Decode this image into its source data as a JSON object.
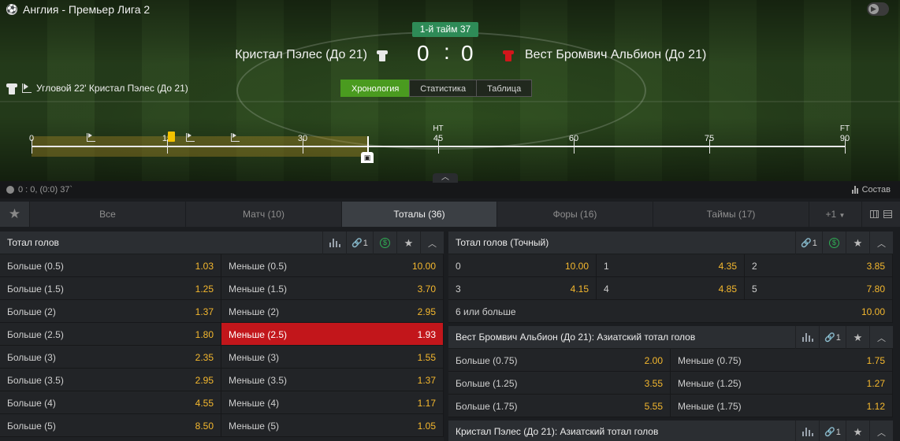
{
  "header": {
    "league": "Англия - Премьер Лига 2",
    "period": "1-й тайм 37",
    "home_team": "Кристал Пэлес (До 21)",
    "away_team": "Вест Бромвич Альбион (До 21)",
    "home_score": "0",
    "separator": ":",
    "away_score": "0",
    "last_event": "Угловой 22' Кристал Пэлес (До 21)",
    "colors": {
      "home_shirt": "#e8e8e8",
      "away_shirt": "#d0161b",
      "accent_green": "#4a9b1f",
      "period_badge": "#2e8b57"
    }
  },
  "view_tabs": [
    {
      "label": "Хронология",
      "active": true
    },
    {
      "label": "Статистика",
      "active": false
    },
    {
      "label": "Таблица",
      "active": false
    }
  ],
  "timeline": {
    "ticks": [
      {
        "label": "0"
      },
      {
        "label": "15"
      },
      {
        "label": "30"
      },
      {
        "label": "45",
        "top": "HT"
      },
      {
        "label": "60"
      },
      {
        "label": "75"
      },
      {
        "label": "90",
        "top": "FT"
      }
    ],
    "current_minute": 37,
    "events": [
      {
        "type": "corner"
      },
      {
        "type": "yellow-card"
      },
      {
        "type": "corner"
      },
      {
        "type": "corner"
      }
    ]
  },
  "status": {
    "score_info": "0 : 0, (0:0) 37`",
    "lineup": "Состав"
  },
  "market_tabs": [
    {
      "label": "Все",
      "active": false
    },
    {
      "label": "Матч (10)",
      "active": false
    },
    {
      "label": "Тоталы (36)",
      "active": true
    },
    {
      "label": "Форы (16)",
      "active": false
    },
    {
      "label": "Таймы (17)",
      "active": false
    },
    {
      "label": "+1",
      "active": false
    }
  ],
  "markets": {
    "total_goals": {
      "title": "Тотал голов",
      "link_count": "1",
      "rows": [
        {
          "over": "Больше (0.5)",
          "over_odd": "1.03",
          "under": "Меньше (0.5)",
          "under_odd": "10.00"
        },
        {
          "over": "Больше (1.5)",
          "over_odd": "1.25",
          "under": "Меньше (1.5)",
          "under_odd": "3.70"
        },
        {
          "over": "Больше (2)",
          "over_odd": "1.37",
          "under": "Меньше (2)",
          "under_odd": "2.95"
        },
        {
          "over": "Больше (2.5)",
          "over_odd": "1.80",
          "under": "Меньше (2.5)",
          "under_odd": "1.93"
        },
        {
          "over": "Больше (3)",
          "over_odd": "2.35",
          "under": "Меньше (3)",
          "under_odd": "1.55"
        },
        {
          "over": "Больше (3.5)",
          "over_odd": "2.95",
          "under": "Меньше (3.5)",
          "under_odd": "1.37"
        },
        {
          "over": "Больше (4)",
          "over_odd": "4.55",
          "under": "Меньше (4)",
          "under_odd": "1.17"
        },
        {
          "over": "Больше (5)",
          "over_odd": "8.50",
          "under": "Меньше (5)",
          "under_odd": "1.05"
        }
      ]
    },
    "exact_goals": {
      "title": "Тотал голов (Точный)",
      "link_count": "1",
      "rows": [
        [
          {
            "label": "0",
            "odd": "10.00"
          },
          {
            "label": "1",
            "odd": "4.35"
          },
          {
            "label": "2",
            "odd": "3.85"
          }
        ],
        [
          {
            "label": "3",
            "odd": "4.15"
          },
          {
            "label": "4",
            "odd": "4.85"
          },
          {
            "label": "5",
            "odd": "7.80"
          }
        ]
      ],
      "last": {
        "label": "6 или больше",
        "odd": "10.00"
      }
    },
    "away_asian": {
      "title": "Вест Бромвич Альбион (До 21): Азиатский тотал голов",
      "link_count": "1",
      "rows": [
        {
          "over": "Больше (0.75)",
          "over_odd": "2.00",
          "under": "Меньше (0.75)",
          "under_odd": "1.75"
        },
        {
          "over": "Больше (1.25)",
          "over_odd": "3.55",
          "under": "Меньше (1.25)",
          "under_odd": "1.27"
        },
        {
          "over": "Больше (1.75)",
          "over_odd": "5.55",
          "under": "Меньше (1.75)",
          "under_odd": "1.12"
        }
      ]
    },
    "home_asian": {
      "title": "Кристал Пэлес (До 21): Азиатский тотал голов",
      "link_count": "1"
    }
  }
}
